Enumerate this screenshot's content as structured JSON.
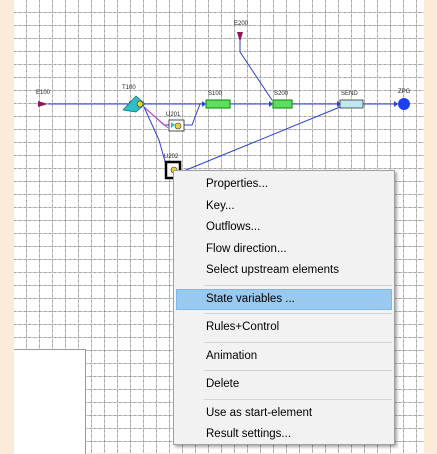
{
  "canvas": {
    "nodes": [
      {
        "id": "e100",
        "label": "E100"
      },
      {
        "id": "t100",
        "label": "T100"
      },
      {
        "id": "u201",
        "label": "U201"
      },
      {
        "id": "u202",
        "label": "U202"
      },
      {
        "id": "s100",
        "label": "S100"
      },
      {
        "id": "e200",
        "label": "E200"
      },
      {
        "id": "s200",
        "label": "S200"
      },
      {
        "id": "send",
        "label": "SEND"
      },
      {
        "id": "zpg",
        "label": "ZPG"
      }
    ]
  },
  "context_menu": {
    "items": [
      {
        "label": "Properties...",
        "highlighted": false
      },
      {
        "label": "Key...",
        "highlighted": false
      },
      {
        "label": "Outflows...",
        "highlighted": false
      },
      {
        "label": "Flow direction...",
        "highlighted": false
      },
      {
        "label": "Select upstream elements",
        "highlighted": false
      },
      {
        "separator": true
      },
      {
        "label": "State variables ...",
        "highlighted": true
      },
      {
        "separator": true
      },
      {
        "label": "Rules+Control",
        "highlighted": false
      },
      {
        "separator": true
      },
      {
        "label": "Animation",
        "highlighted": false
      },
      {
        "separator": true
      },
      {
        "label": "Delete",
        "highlighted": false
      },
      {
        "separator": true
      },
      {
        "label": "Use as start-element",
        "highlighted": false
      },
      {
        "label": "Result settings...",
        "highlighted": false
      }
    ]
  },
  "colors": {
    "flow_line": "#2b3fd6",
    "highlight": "#99c9ef",
    "source_marker": "#8b1a5c",
    "storage_green": "#1a9c1a",
    "zpg_blue": "#1e3ff0"
  }
}
